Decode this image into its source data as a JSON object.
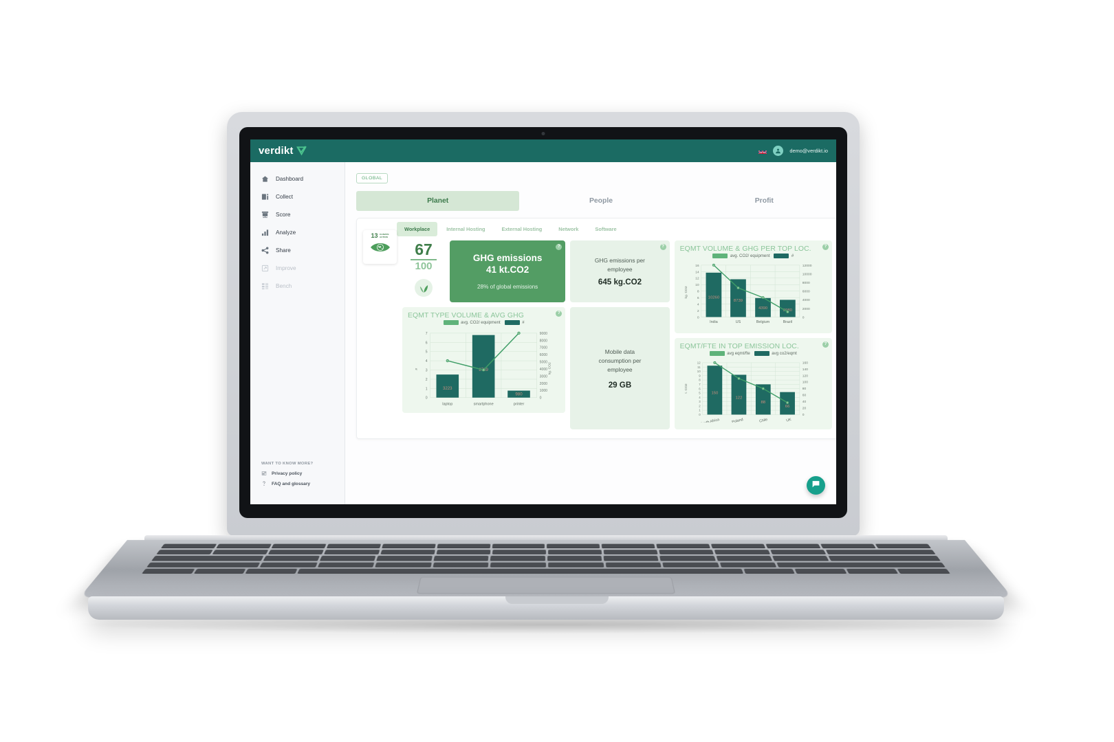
{
  "app": {
    "brand": "verdikt",
    "brand_icon": "check-mark-icon",
    "flag_icon": "uk-flag-icon",
    "user_email": "demo@verdikt.io",
    "accent": "#1b6b63",
    "primary_green": "#539d64",
    "light_green": "#e7f2e8"
  },
  "sidebar": {
    "items": [
      {
        "label": "Dashboard",
        "icon": "home-icon",
        "disabled": false
      },
      {
        "label": "Collect",
        "icon": "document-icon",
        "disabled": false
      },
      {
        "label": "Score",
        "icon": "presentation-icon",
        "disabled": false
      },
      {
        "label": "Analyze",
        "icon": "bar-chart-icon",
        "disabled": false
      },
      {
        "label": "Share",
        "icon": "share-icon",
        "disabled": false
      },
      {
        "label": "Improve",
        "icon": "improve-icon",
        "disabled": true
      },
      {
        "label": "Bench",
        "icon": "bench-icon",
        "disabled": true
      }
    ],
    "footer_title": "WANT TO KNOW MORE?",
    "footer_items": [
      {
        "label": "Privacy policy",
        "icon": "privacy-icon"
      },
      {
        "label": "FAQ and glossary",
        "icon": "faq-icon"
      }
    ]
  },
  "content": {
    "scope_chip": "GLOBAL",
    "top_tabs": [
      {
        "label": "Planet",
        "active": true
      },
      {
        "label": "People",
        "active": false
      },
      {
        "label": "Profit",
        "active": false
      }
    ],
    "sub_tabs": [
      {
        "label": "Workplace",
        "active": true
      },
      {
        "label": "Internal Hosting",
        "active": false
      },
      {
        "label": "External Hosting",
        "active": false
      },
      {
        "label": "Network",
        "active": false
      },
      {
        "label": "Software",
        "active": false
      }
    ],
    "sdg_badge": {
      "number": "13",
      "line1": "CLIMATE",
      "line2": "ACTION",
      "icon": "globe-eye-icon"
    },
    "score": {
      "value": "67",
      "max": "100",
      "badge_icon": "leaf-icon"
    },
    "kpi_main": {
      "title": "GHG emissions",
      "value": "41 kt.CO2",
      "subtitle": "28% of global emissions",
      "help": "?"
    },
    "kpi_per_employee": {
      "title_line1": "GHG emissions per",
      "title_line2": "employee",
      "value": "645 kg.CO2",
      "help": "?"
    },
    "kpi_mobile_data": {
      "title_line1": "Mobile data",
      "title_line2": "consumption per",
      "title_line3": "employee",
      "value": "29 GB"
    },
    "fab_icon": "chat-icon"
  },
  "chart_data": [
    {
      "id": "eqmt-type-volume",
      "type": "bar",
      "title": "EQMT TYPE VOLUME & AVG GHG",
      "categories": [
        "laptop",
        "smartphone",
        "printer"
      ],
      "series": [
        {
          "name": "#",
          "kind": "bar",
          "axis": "right",
          "values": [
            3223,
            8739,
            980
          ],
          "color": "#1f6a62"
        },
        {
          "name": "avg. CO2/ equipment",
          "kind": "line",
          "axis": "left",
          "values": [
            4.0,
            3.0,
            7.0
          ],
          "color": "#46a06a"
        }
      ],
      "legend": [
        "avg. CO2/ equipment",
        "#"
      ],
      "legend_position": "top",
      "ylabel": "#",
      "ylabel_right": "kg. CO2",
      "ylim": [
        0,
        7
      ],
      "yticks": [
        0,
        1,
        2,
        3,
        4,
        5,
        6,
        7
      ],
      "ylim_right": [
        0,
        9000
      ],
      "yticks_right": [
        0,
        1000,
        2000,
        3000,
        4000,
        5000,
        6000,
        7000,
        8000,
        9000
      ],
      "grid": true,
      "bar_labels": [
        "3223",
        "8739",
        "980"
      ]
    },
    {
      "id": "eqmt-volume-ghg-top-loc",
      "type": "bar",
      "title": "EQMT VOLUME & GHG PER TOP LOC.",
      "categories": [
        "India",
        "US",
        "Belgium",
        "Brazil"
      ],
      "series": [
        {
          "name": "#",
          "kind": "bar",
          "axis": "right",
          "values": [
            10260,
            8739,
            4390,
            3980
          ],
          "color": "#1f6a62"
        },
        {
          "name": "avg. CO2/ equipment",
          "kind": "line",
          "axis": "left",
          "values": [
            16.0,
            9.0,
            6.0,
            2.0
          ],
          "color": "#46a06a"
        }
      ],
      "legend": [
        "avg. CO2/ equipment",
        "#"
      ],
      "legend_position": "top",
      "ylabel": "kg. CO2",
      "ylim": [
        0,
        16
      ],
      "yticks": [
        0,
        2,
        4,
        6,
        8,
        10,
        12,
        14,
        16
      ],
      "ylim_right": [
        0,
        12000
      ],
      "yticks_right": [
        0,
        2000,
        4000,
        6000,
        8000,
        10000,
        12000
      ],
      "grid": true,
      "bar_labels": [
        "10260",
        "8739",
        "4390",
        "3980"
      ]
    },
    {
      "id": "eqmt-fte-top-emission-loc",
      "type": "bar",
      "title": "EQMT/FTE IN TOP EMISSION LOC.",
      "categories": [
        "South Africa",
        "Poland",
        "Chile",
        "UK"
      ],
      "series": [
        {
          "name": "avg co2/eqmt",
          "kind": "bar",
          "axis": "left",
          "values": [
            11.3,
            9.2,
            7.0,
            5.2
          ],
          "color": "#1f6a62"
        },
        {
          "name": "avg eqmt/fte",
          "kind": "line",
          "axis": "right",
          "values": [
            160,
            110,
            80,
            40
          ],
          "color": "#46a06a"
        }
      ],
      "legend": [
        "avg eqmt/fte",
        "avg co2/eqmt"
      ],
      "legend_position": "top",
      "ylabel": "t. CO2",
      "ylim": [
        0,
        12
      ],
      "yticks": [
        0,
        1,
        2,
        3,
        4,
        5,
        6,
        7,
        8,
        9,
        10,
        11,
        12
      ],
      "ylim_right": [
        0,
        160
      ],
      "yticks_right": [
        0,
        20,
        40,
        60,
        80,
        100,
        120,
        140,
        160
      ],
      "grid": true,
      "bar_labels": [
        "150",
        "122",
        "88",
        "66"
      ]
    }
  ]
}
